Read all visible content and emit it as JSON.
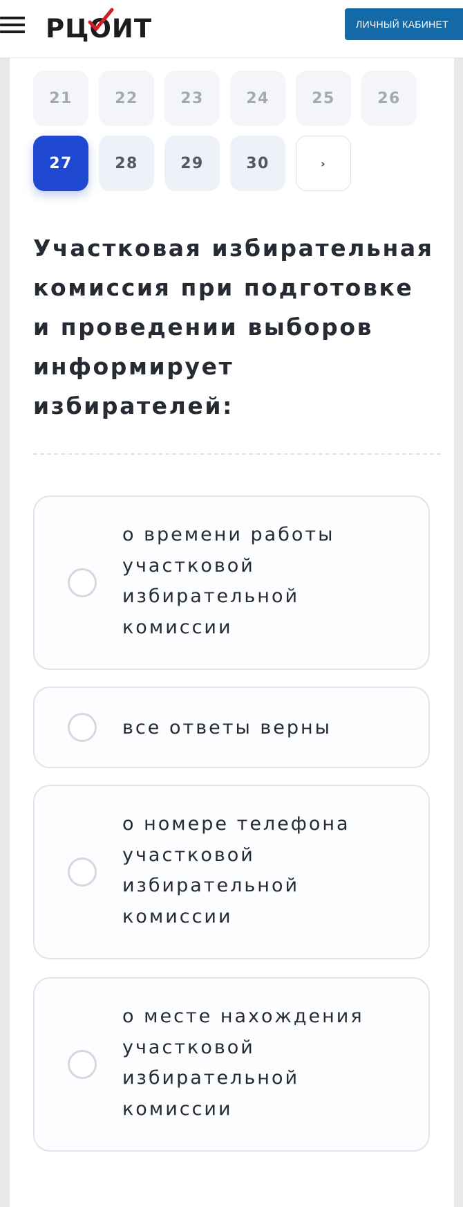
{
  "header": {
    "menu_icon": "hamburger-menu-icon",
    "logo_text": "РЦОИТ",
    "logo_mark": "red-checkmark-icon",
    "logo_mark_color": "#d21f26",
    "cabinet_button": "ЛИЧНЫЙ КАБИНЕТ",
    "cabinet_button_color": "#136aa6"
  },
  "pagination": {
    "row1": [
      "21",
      "22",
      "23",
      "24",
      "25",
      "26"
    ],
    "row2": [
      "27",
      "28",
      "29",
      "30"
    ],
    "active": "27",
    "next_label": "›",
    "active_color": "#1e48cf"
  },
  "question": {
    "text": "Участковая избирательная комиссия при подготовке и проведении выборов информирует избирателей:"
  },
  "answers": [
    {
      "text": "о времени работы участковой избирательной комиссии",
      "selected": false
    },
    {
      "text": "все ответы верны",
      "selected": false
    },
    {
      "text": "о номере телефона участковой избирательной комиссии",
      "selected": false
    },
    {
      "text": "о месте нахождения участковой избирательной комиссии",
      "selected": false
    }
  ]
}
